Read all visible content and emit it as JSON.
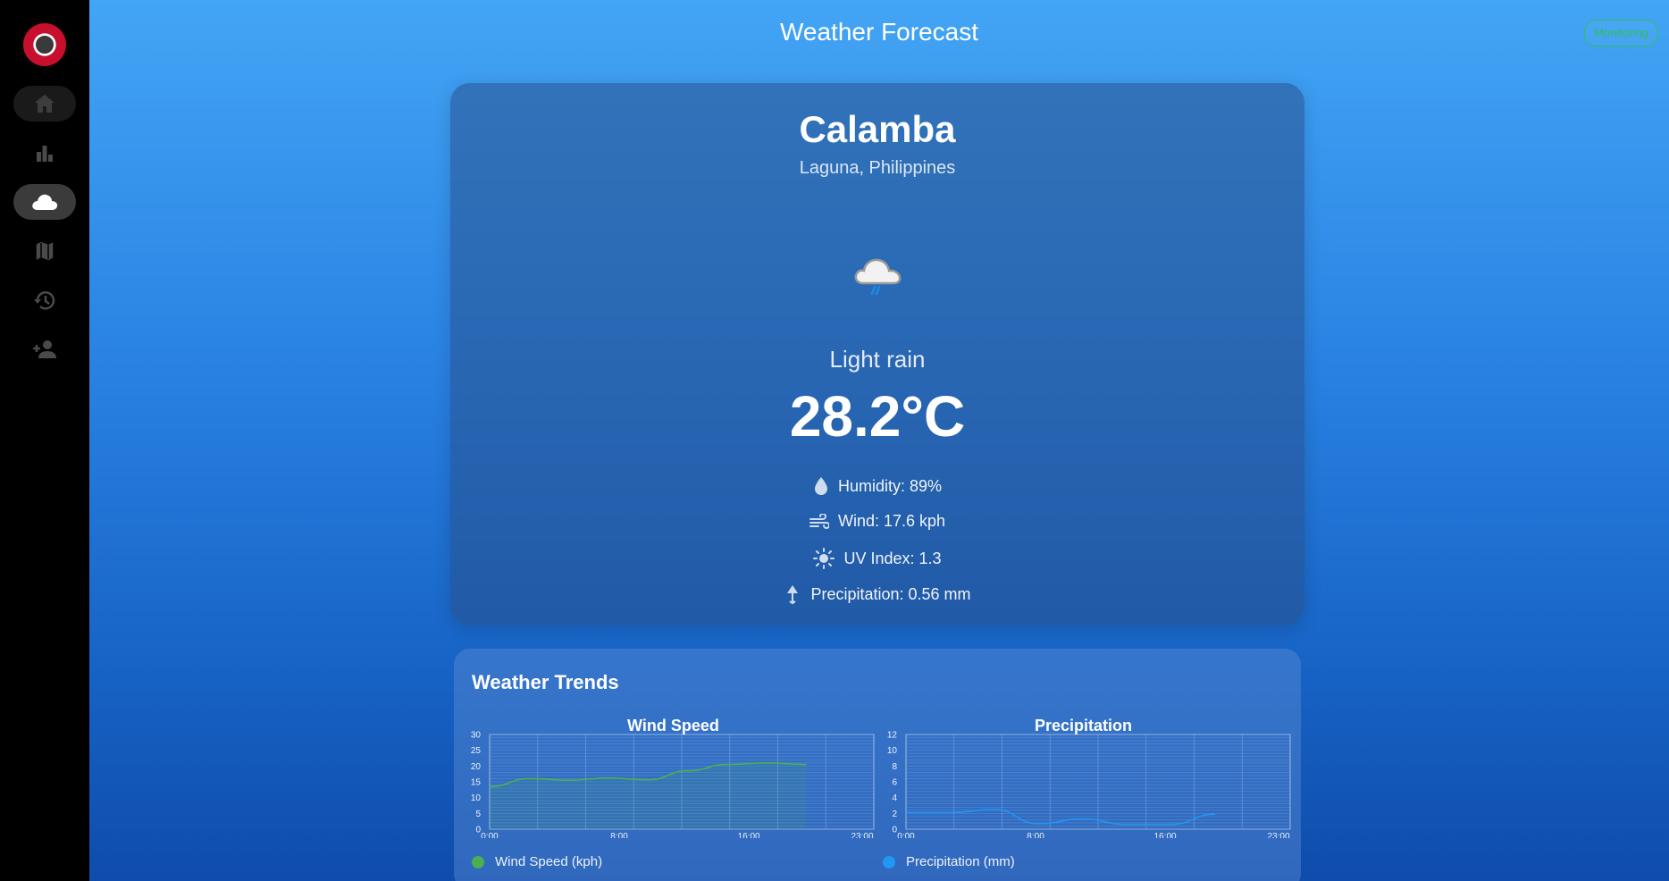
{
  "app": {
    "status_badge": "Monitoring"
  },
  "sidebar": {
    "items": [
      {
        "icon": "home-icon"
      },
      {
        "icon": "bar-chart-icon"
      },
      {
        "icon": "cloud-icon",
        "active": true
      },
      {
        "icon": "map-icon"
      },
      {
        "icon": "history-icon"
      },
      {
        "icon": "add-user-icon"
      }
    ]
  },
  "header": {
    "title": "Weather Forecast"
  },
  "current": {
    "city": "Calamba",
    "region": "Laguna, Philippines",
    "condition": "Light rain",
    "temperature": "28.2°C",
    "humidity": "Humidity: 89%",
    "wind": "Wind: 17.6 kph",
    "uv": "UV Index: 1.3",
    "precipitation": "Precipitation: 0.56 mm"
  },
  "trends": {
    "title": "Weather Trends",
    "wind_chart_title": "Wind Speed",
    "precip_chart_title": "Precipitation",
    "wind_legend": "Wind Speed (kph)",
    "precip_legend": "Precipitation (mm)"
  },
  "colors": {
    "wind": "#4caf50",
    "precip": "#2196f3",
    "status": "#2ebf5a"
  },
  "chart_data": [
    {
      "type": "line",
      "title": "Wind Speed",
      "x": [
        0,
        2,
        4,
        6,
        8,
        10,
        12,
        14,
        16,
        18,
        20
      ],
      "x_ticks": [
        "0:00",
        "8:00",
        "16:00",
        "23:00"
      ],
      "x_range": [
        0,
        23
      ],
      "y_ticks": [
        "0",
        "5",
        "10",
        "15",
        "20",
        "25",
        "30"
      ],
      "ylim": [
        0,
        30
      ],
      "grid": true,
      "series": [
        {
          "name": "Wind Speed (kph)",
          "color": "#4caf50",
          "values": [
            13.5,
            16,
            15.5,
            16.2,
            15.6,
            18.5,
            20.5,
            21,
            20.5
          ]
        }
      ],
      "legend": "bottom"
    },
    {
      "type": "line",
      "title": "Precipitation",
      "x_ticks": [
        "0:00",
        "8:00",
        "16:00",
        "23:00"
      ],
      "x_range": [
        0,
        23
      ],
      "y_ticks": [
        "0",
        "2",
        "4",
        "6",
        "8",
        "10",
        "12"
      ],
      "ylim": [
        0,
        12
      ],
      "grid": true,
      "series": [
        {
          "name": "Precipitation (mm)",
          "color": "#2196f3",
          "values": [
            2.1,
            2.1,
            2.5,
            0.7,
            1.3,
            0.6,
            0.6,
            1.9
          ]
        }
      ],
      "legend": "bottom"
    }
  ]
}
